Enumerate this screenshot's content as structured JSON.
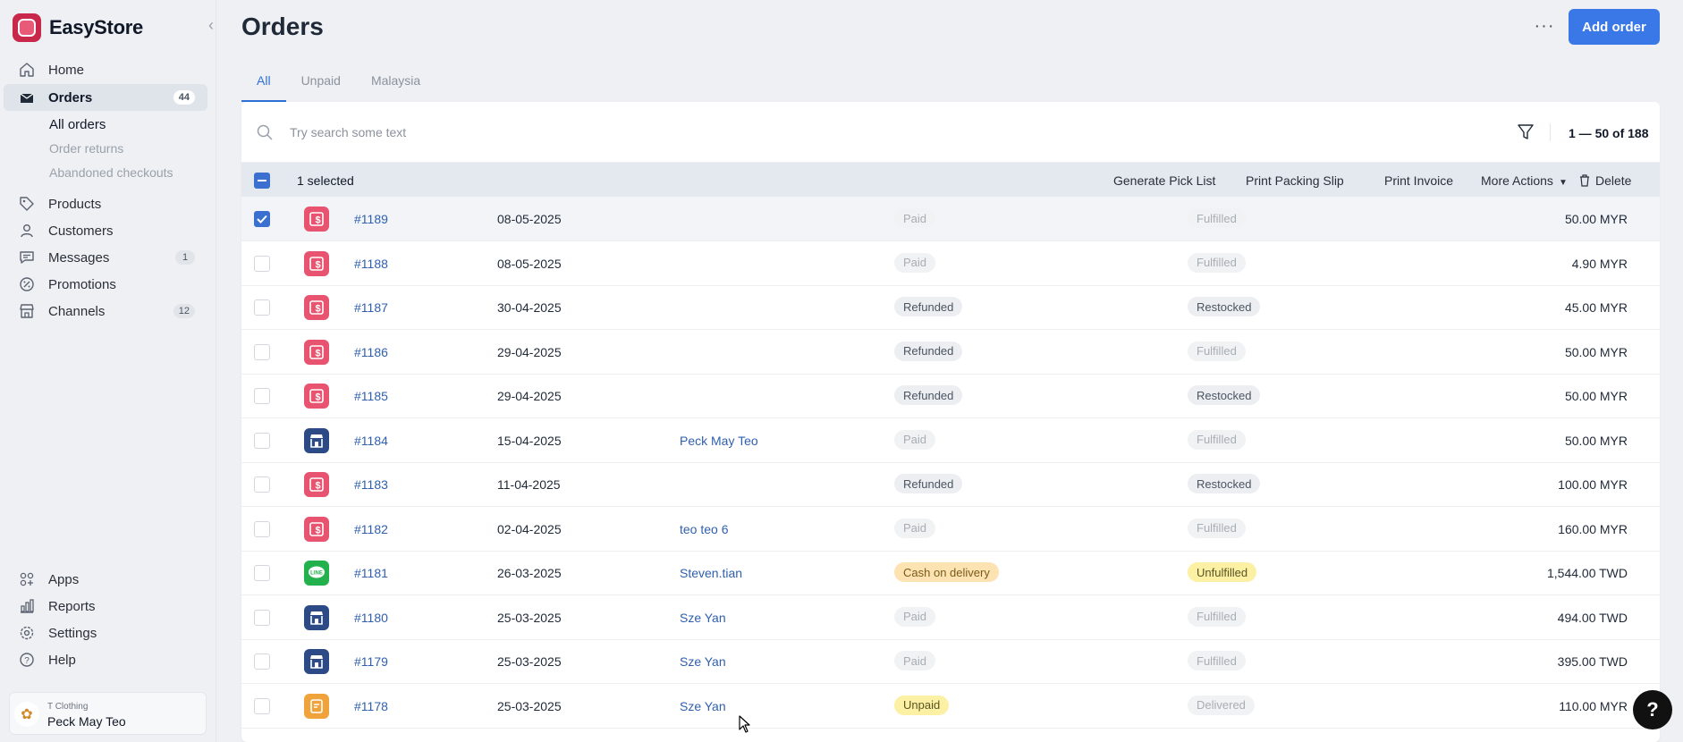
{
  "brand": {
    "name": "EasyStore"
  },
  "sidebar": {
    "items": [
      {
        "label": "Home",
        "icon": "home-icon"
      },
      {
        "label": "Orders",
        "icon": "orders-icon",
        "badge": "44",
        "active": true
      },
      {
        "label": "Products",
        "icon": "tag-icon"
      },
      {
        "label": "Customers",
        "icon": "user-icon"
      },
      {
        "label": "Messages",
        "icon": "chat-icon",
        "badge": "1"
      },
      {
        "label": "Promotions",
        "icon": "promotions-icon"
      },
      {
        "label": "Channels",
        "icon": "store-icon",
        "badge": "12"
      }
    ],
    "subitems": [
      "All orders",
      "Order returns",
      "Abandoned checkouts"
    ],
    "bottom_items": [
      {
        "label": "Apps",
        "icon": "apps-icon"
      },
      {
        "label": "Reports",
        "icon": "reports-icon"
      },
      {
        "label": "Settings",
        "icon": "gear-icon"
      },
      {
        "label": "Help",
        "icon": "help-icon"
      }
    ],
    "store": {
      "name": "T Clothing",
      "user": "Peck May Teo"
    }
  },
  "header": {
    "title": "Orders",
    "more": "···",
    "add_button": "Add order"
  },
  "tabs": [
    "All",
    "Unpaid",
    "Malaysia"
  ],
  "search": {
    "placeholder": "Try search some text"
  },
  "pagination": "1 — 50 of 188",
  "bulk": {
    "selected": "1 selected",
    "actions": [
      "Generate Pick List",
      "Print Packing Slip",
      "Print Invoice",
      "More Actions",
      "Delete"
    ]
  },
  "orders": [
    {
      "number": "#1189",
      "date": "08-05-2025",
      "customer": "",
      "payment": "Paid",
      "fulfillment": "Fulfilled",
      "amount": "50.00 MYR",
      "channel": "pos",
      "checked": true
    },
    {
      "number": "#1188",
      "date": "08-05-2025",
      "customer": "",
      "payment": "Paid",
      "fulfillment": "Fulfilled",
      "amount": "4.90 MYR",
      "channel": "pos"
    },
    {
      "number": "#1187",
      "date": "30-04-2025",
      "customer": "",
      "payment": "Refunded",
      "fulfillment": "Restocked",
      "amount": "45.00 MYR",
      "channel": "pos"
    },
    {
      "number": "#1186",
      "date": "29-04-2025",
      "customer": "",
      "payment": "Refunded",
      "fulfillment": "Fulfilled",
      "amount": "50.00 MYR",
      "channel": "pos"
    },
    {
      "number": "#1185",
      "date": "29-04-2025",
      "customer": "",
      "payment": "Refunded",
      "fulfillment": "Restocked",
      "amount": "50.00 MYR",
      "channel": "pos"
    },
    {
      "number": "#1184",
      "date": "15-04-2025",
      "customer": "Peck May Teo",
      "payment": "Paid",
      "fulfillment": "Fulfilled",
      "amount": "50.00 MYR",
      "channel": "store"
    },
    {
      "number": "#1183",
      "date": "11-04-2025",
      "customer": "",
      "payment": "Refunded",
      "fulfillment": "Restocked",
      "amount": "100.00 MYR",
      "channel": "pos"
    },
    {
      "number": "#1182",
      "date": "02-04-2025",
      "customer": "teo teo 6",
      "payment": "Paid",
      "fulfillment": "Fulfilled",
      "amount": "160.00 MYR",
      "channel": "pos"
    },
    {
      "number": "#1181",
      "date": "26-03-2025",
      "customer": "Steven.tian",
      "payment": "Cash on delivery",
      "fulfillment": "Unfulfilled",
      "amount": "1,544.00 TWD",
      "channel": "line"
    },
    {
      "number": "#1180",
      "date": "25-03-2025",
      "customer": "Sze Yan",
      "payment": "Paid",
      "fulfillment": "Fulfilled",
      "amount": "494.00 TWD",
      "channel": "store"
    },
    {
      "number": "#1179",
      "date": "25-03-2025",
      "customer": "Sze Yan",
      "payment": "Paid",
      "fulfillment": "Fulfilled",
      "amount": "395.00 TWD",
      "channel": "store"
    },
    {
      "number": "#1178",
      "date": "25-03-2025",
      "customer": "Sze Yan",
      "payment": "Unpaid",
      "fulfillment": "Delivered",
      "amount": "110.00 MYR",
      "channel": "draft"
    }
  ],
  "help_fab": "?",
  "colors": {
    "accent": "#3b78e7",
    "brand": "#c8284a",
    "link": "#2f5fae",
    "pos_channel": "#e8536f",
    "store_channel": "#2c4a86",
    "line_channel": "#22b14c",
    "draft_channel": "#f0a33a"
  }
}
